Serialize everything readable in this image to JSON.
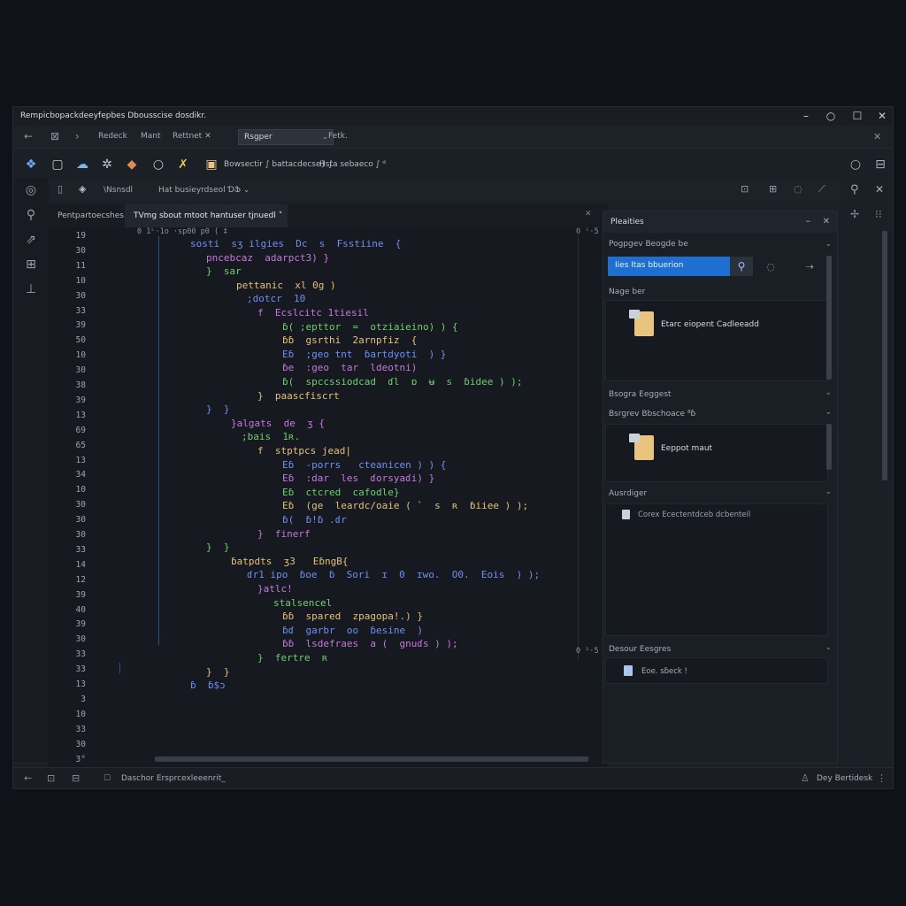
{
  "window": {
    "title": "Rempicbopackdeeyfepbes Dbousscise dosdikr.",
    "controls": {
      "minimize": "–",
      "restore": "○",
      "maximize": "☐",
      "close": "✕"
    }
  },
  "nav": {
    "crumbs": [
      "Redeck",
      "Mant",
      "Rettnet ✕"
    ],
    "selected": "Rsgper",
    "extra": "Fetk.",
    "close": "✕"
  },
  "toolbar": {
    "path_label": "Bowsectir ∫ battacdecse} ∫ ",
    "path_label2": "Hsta sebaeco ∫ ᵈ",
    "icon_names": [
      "git-icon",
      "chat-icon",
      "cloud-icon",
      "settings-icon",
      "debug-icon",
      "circle-icon",
      "split-icon",
      "folder-icon"
    ]
  },
  "toolbar2": {
    "label1": "\\Nsnsdl",
    "label2": "Hat busieyrdseol ƊՖ ⌄"
  },
  "editor": {
    "tabs": [
      {
        "label": "Pentpartoecshes",
        "active": false
      },
      {
        "label": "TVmg sbout mtoot hantuser tjnuedl ˅",
        "active": true
      }
    ],
    "tab_close": "✕",
    "header_left": "0 1ᴸ·1o ·sp00 p0 ( ‡",
    "header_right": "0 ˡ·5",
    "footer_right": "0 ¹·5",
    "line_numbers": [
      "19",
      "30",
      "11",
      "10",
      "30",
      "33",
      "39",
      "50",
      "10",
      "30",
      "38",
      "39",
      "13",
      "69",
      "65",
      "13",
      "34",
      "10",
      "30",
      "30",
      "30",
      "33",
      "14",
      "12",
      "39",
      "40",
      "39",
      "30",
      "33",
      "33",
      "13",
      "3",
      "10",
      "33",
      "30",
      "3°"
    ],
    "code": [
      "sosti  sʒ ilgies  Dc  s  Fsstiine  {",
      "pncebcaz  adarpct3) }",
      "}  sar",
      "pettanic  xl 0g )",
      ";dotcr  10",
      "f  Ecslcitc 1tiesil",
      "ɓ( ;epttor  =  otziaieino) ) {",
      "ɓɓ  gsrthi  2arnpfiz  {",
      "Eɓ  ;geo tnt  ɓartdyoti  ) }",
      "ɓe  :geo  tar  ldeotni)",
      "ɓ(  spccssiodcad  ɗl  ɒ  ʉ  s  ɓidee ) );",
      "}  paascfiscrt",
      "}  }",
      "}algats  de  ʒ {",
      ";bais  1ʀ.",
      "f  stptpcs jead|",
      "Eɓ  -porrs   cteanicen ) ) {",
      "Eɓ  :dar  les  ɗorsyaɗi) }",
      "Eɓ  ctcred  cafodle}",
      "Eɓ  (ge  leardc/oaie ( `  s  ʀ  ɓiiee ) );",
      "ɓ(  ɓ!ɓ .ɗr",
      "}  finerf",
      "}  }",
      "ɓatpdts  ʒ3   EɓngB{",
      "ɗr1 ipo  ɓoe  ɓ  Sori  ɪ  0  ɪwo.  O0.  Eois  ) );",
      "}atlc!",
      "stalsencel",
      "ɓɓ  spared  zpagopa!.) }",
      "ɓɗ  garbr  oo  ɓesine  )",
      "ɓɓ  lsdefraes  a (  gnuɗs ) );",
      "}  fertre  ʀ",
      "}  }",
      "ɓ  ɓ$ɔ"
    ]
  },
  "panel": {
    "title": "Pleaities",
    "section_search": "Pogpgev Beogde be",
    "search_value": "Iies ltas bbuerion",
    "section1": "Nage ber",
    "file1": "Etarc eiopent Cadleeadd",
    "section2": "Bsogra Eeggest",
    "section3": "Bsrgrev Bbschoace ⁸ɓ",
    "file2": "Eeppot maut",
    "section4": "Ausrdiger",
    "file3": "Corex Ecectentdceb dcbenteil",
    "section5": "Desour Eesgres",
    "file4": "Eoe. sɓeck !"
  },
  "status": {
    "left_text": "Daschor Ersprcexleeenrit_",
    "right_text": "Dey Bertidesk"
  },
  "colors": {
    "accent": "#1f6fd0",
    "keyword_blue": "#6f8ff5",
    "keyword_purple": "#c678dd",
    "string_green": "#6fcf6f",
    "text_yellow": "#e5c07b"
  }
}
